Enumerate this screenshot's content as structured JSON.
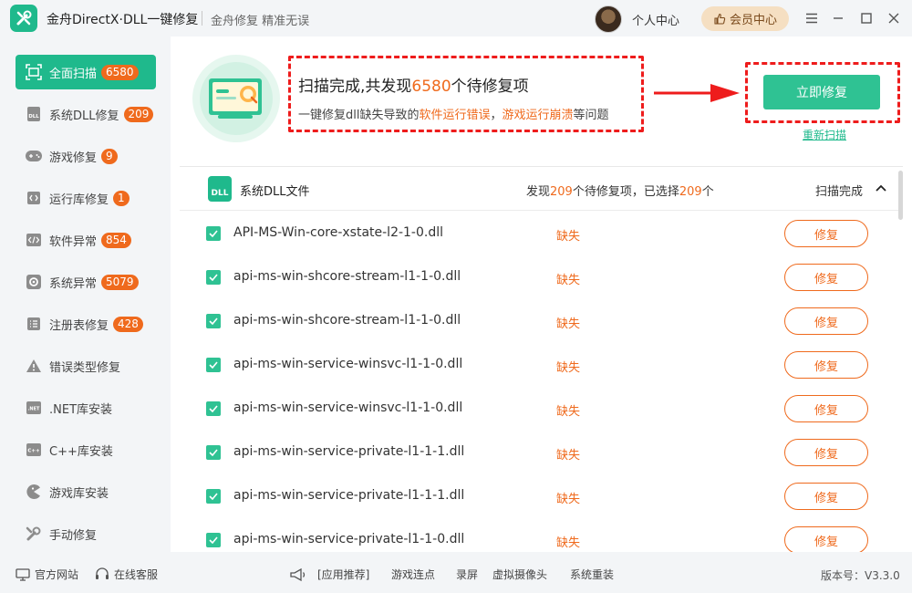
{
  "titlebar": {
    "app_title": "金舟DirectX·DLL一键修复",
    "slogan": "金舟修复 精准无误",
    "personal_center": "个人中心",
    "vip_center": "会员中心"
  },
  "sidebar": {
    "items": [
      {
        "label": "全面扫描",
        "badge": "6580",
        "icon": "scan-icon"
      },
      {
        "label": "系统DLL修复",
        "badge": "209",
        "icon": "dll-icon"
      },
      {
        "label": "游戏修复",
        "badge": "9",
        "icon": "gamepad-icon"
      },
      {
        "label": "运行库修复",
        "badge": "1",
        "icon": "runtime-icon"
      },
      {
        "label": "软件异常",
        "badge": "854",
        "icon": "code-icon"
      },
      {
        "label": "系统异常",
        "badge": "5079",
        "icon": "gear-icon"
      },
      {
        "label": "注册表修复",
        "badge": "428",
        "icon": "list-icon"
      },
      {
        "label": "错误类型修复",
        "badge": "",
        "icon": "warning-icon"
      },
      {
        "label": ".NET库安装",
        "badge": "",
        "icon": "dotnet-icon"
      },
      {
        "label": "C++库安装",
        "badge": "",
        "icon": "cpp-icon"
      },
      {
        "label": "游戏库安装",
        "badge": "",
        "icon": "pacman-icon"
      },
      {
        "label": "手动修复",
        "badge": "",
        "icon": "wrench-icon"
      }
    ]
  },
  "scan": {
    "title_prefix": "扫描完成,共发现",
    "count": "6580",
    "title_suffix": "个待修复项",
    "sub_prefix": "一键修复dll缺失导致的",
    "sub_hl1": "软件运行错误",
    "sub_sep": "，",
    "sub_hl2": "游戏运行崩溃",
    "sub_suffix": "等问题",
    "fix_now": "立即修复",
    "rescan": "重新扫描"
  },
  "group": {
    "title": "系统DLL文件",
    "icon_text": "DLL",
    "summary_prefix": "发现",
    "found": "209",
    "summary_mid": "个待修复项，已选择",
    "selected": "209",
    "summary_suffix": "个",
    "status": "扫描完成"
  },
  "rows": [
    {
      "name": "API-MS-Win-core-xstate-l2-1-0.dll",
      "status": "缺失",
      "action": "修复"
    },
    {
      "name": "api-ms-win-shcore-stream-l1-1-0.dll",
      "status": "缺失",
      "action": "修复"
    },
    {
      "name": "api-ms-win-shcore-stream-l1-1-0.dll",
      "status": "缺失",
      "action": "修复"
    },
    {
      "name": "api-ms-win-service-winsvc-l1-1-0.dll",
      "status": "缺失",
      "action": "修复"
    },
    {
      "name": "api-ms-win-service-winsvc-l1-1-0.dll",
      "status": "缺失",
      "action": "修复"
    },
    {
      "name": "api-ms-win-service-private-l1-1-1.dll",
      "status": "缺失",
      "action": "修复"
    },
    {
      "name": "api-ms-win-service-private-l1-1-1.dll",
      "status": "缺失",
      "action": "修复"
    },
    {
      "name": "api-ms-win-service-private-l1-1-0.dll",
      "status": "缺失",
      "action": "修复"
    }
  ],
  "footer": {
    "website": "官方网站",
    "support": "在线客服",
    "recommend": "[应用推荐]",
    "links": [
      "游戏连点",
      "录屏",
      "虚拟摄像头",
      "系统重装"
    ],
    "version": "版本号：V3.3.0"
  },
  "colors": {
    "accent": "#1fb98c",
    "warning": "#ef6a1d",
    "annotation": "#ee1c1c"
  }
}
